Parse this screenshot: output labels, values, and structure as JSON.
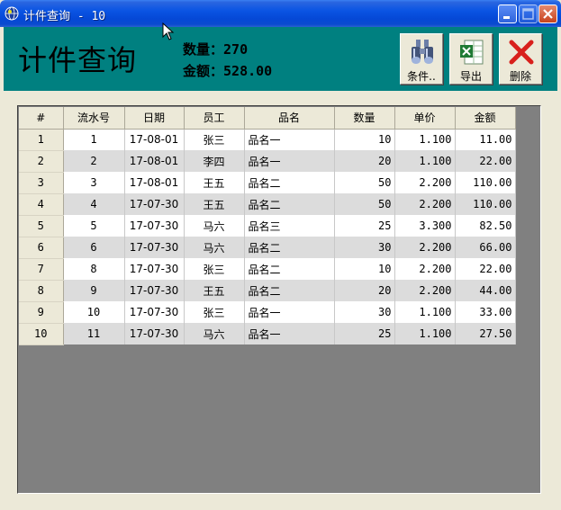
{
  "window": {
    "title": "计件查询 - 10",
    "app_icon": "globe-icon"
  },
  "header": {
    "title": "计件查询",
    "quantity_label": "数量：",
    "quantity_value": "270",
    "amount_label": "金额：",
    "amount_value": "528.00"
  },
  "toolbar": {
    "condition_label": "条件..",
    "export_label": "导出",
    "delete_label": "删除"
  },
  "table": {
    "columns": [
      "#",
      "流水号",
      "日期",
      "员工",
      "品名",
      "数量",
      "单价",
      "金额"
    ],
    "rows": [
      [
        "1",
        "1",
        "17-08-01",
        "张三",
        "品名一",
        "10",
        "1.100",
        "11.00"
      ],
      [
        "2",
        "2",
        "17-08-01",
        "李四",
        "品名一",
        "20",
        "1.100",
        "22.00"
      ],
      [
        "3",
        "3",
        "17-08-01",
        "王五",
        "品名二",
        "50",
        "2.200",
        "110.00"
      ],
      [
        "4",
        "4",
        "17-07-30",
        "王五",
        "品名二",
        "50",
        "2.200",
        "110.00"
      ],
      [
        "5",
        "5",
        "17-07-30",
        "马六",
        "品名三",
        "25",
        "3.300",
        "82.50"
      ],
      [
        "6",
        "6",
        "17-07-30",
        "马六",
        "品名二",
        "30",
        "2.200",
        "66.00"
      ],
      [
        "7",
        "8",
        "17-07-30",
        "张三",
        "品名二",
        "10",
        "2.200",
        "22.00"
      ],
      [
        "8",
        "9",
        "17-07-30",
        "王五",
        "品名二",
        "20",
        "2.200",
        "44.00"
      ],
      [
        "9",
        "10",
        "17-07-30",
        "张三",
        "品名一",
        "30",
        "1.100",
        "33.00"
      ],
      [
        "10",
        "11",
        "17-07-30",
        "马六",
        "品名一",
        "25",
        "1.100",
        "27.50"
      ]
    ]
  },
  "colors": {
    "header_bg": "#008080",
    "titlebar": "#0a54e3",
    "client_bg": "#808080",
    "row_alt": "#dcdcdc"
  }
}
